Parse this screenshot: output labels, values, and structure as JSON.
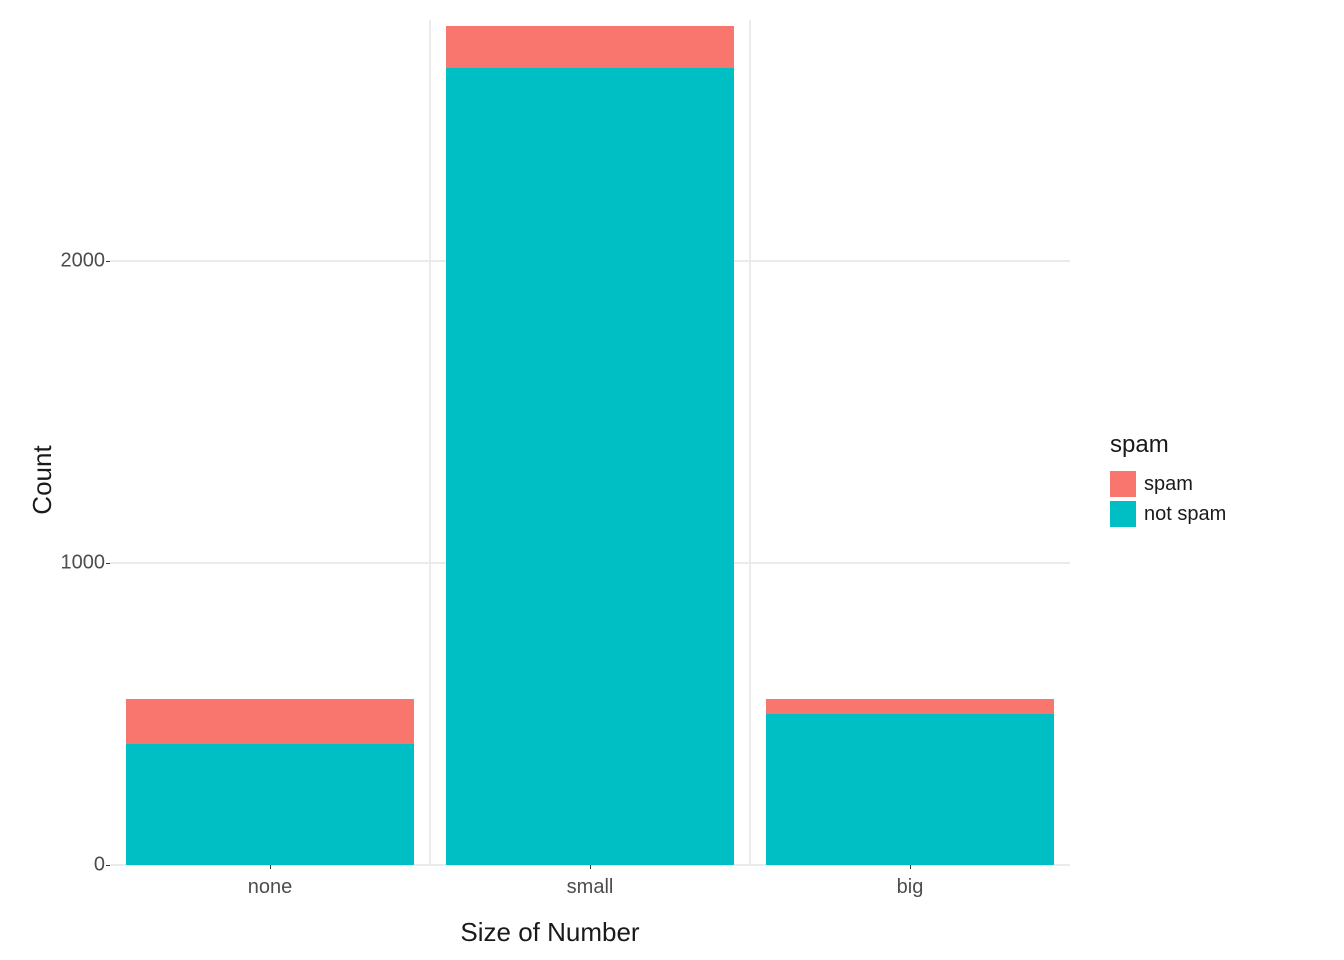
{
  "chart_data": {
    "type": "bar",
    "stacked": true,
    "categories": [
      "none",
      "small",
      "big"
    ],
    "series": [
      {
        "name": "spam",
        "values": [
          150,
          140,
          50
        ],
        "color": "#F8766D"
      },
      {
        "name": "not spam",
        "values": [
          400,
          2640,
          500
        ],
        "color": "#00BFC4"
      }
    ],
    "xlabel": "Size of Number",
    "ylabel": "Count",
    "ylim": [
      0,
      2800
    ],
    "y_ticks": [
      0,
      1000,
      2000
    ],
    "legend_title": "spam"
  },
  "colors": {
    "spam": "#F8766D",
    "not_spam": "#00BFC4",
    "grid": "#ebebeb",
    "text": "#1a1a1a",
    "tick_text": "#4d4d4d"
  }
}
